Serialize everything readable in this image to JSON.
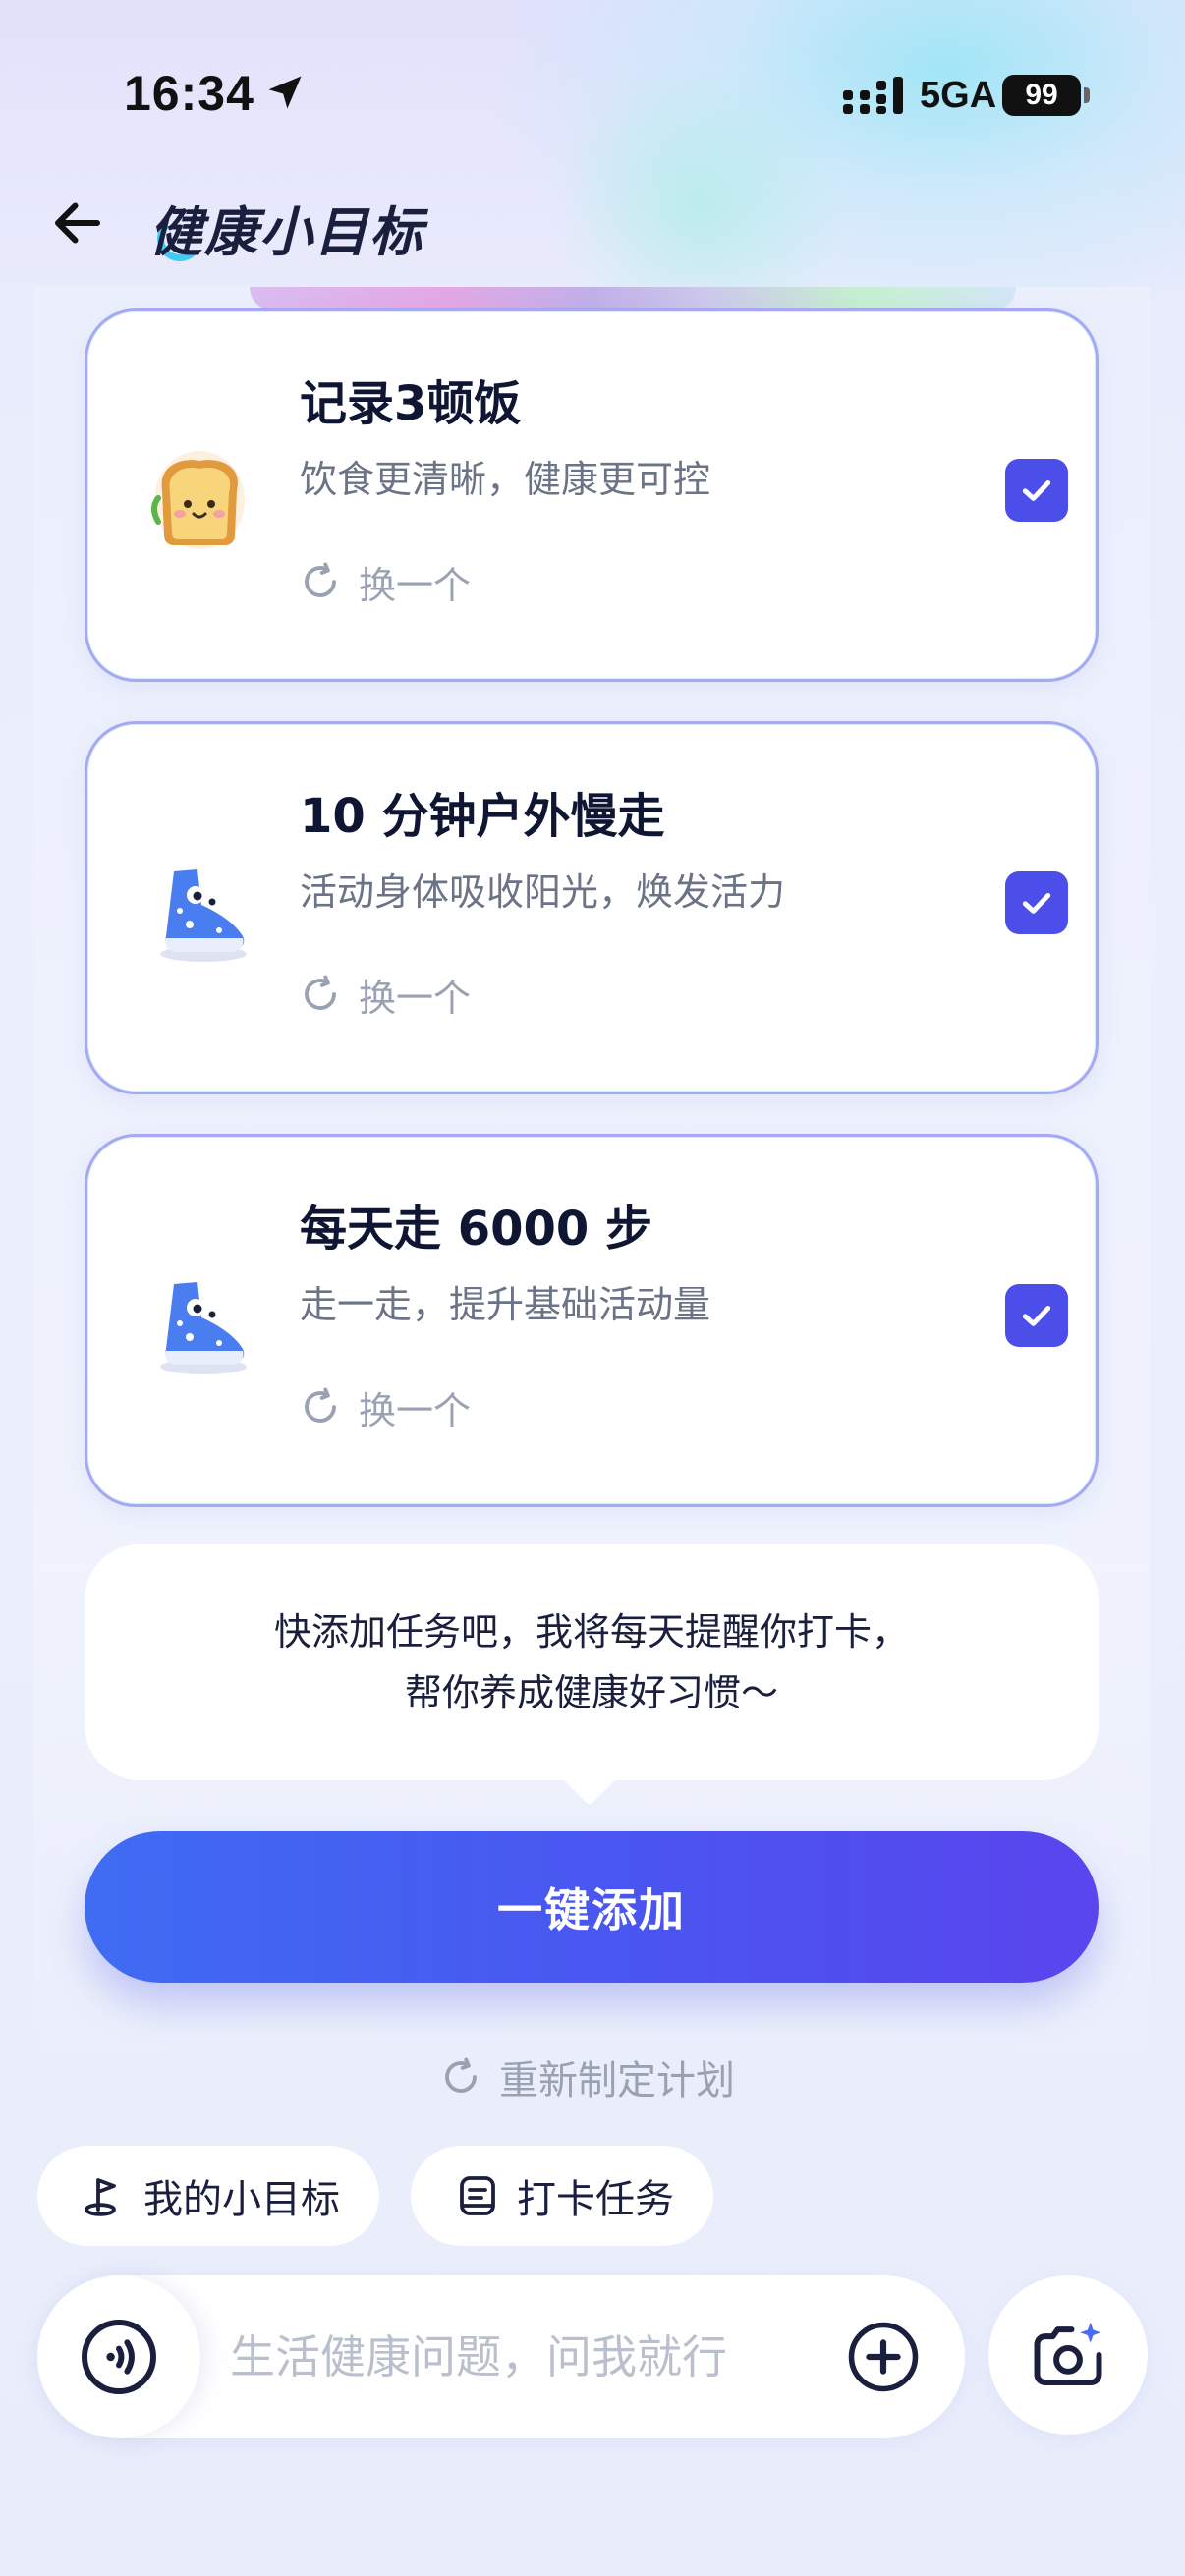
{
  "status_bar": {
    "time": "16:34",
    "network": "5GA",
    "battery": "99"
  },
  "header": {
    "title": "健康小目标"
  },
  "goals": [
    {
      "title": "记录3顿饭",
      "description": "饮食更清晰，健康更可控",
      "swap_label": "换一个",
      "checked": true,
      "icon": "toast-icon"
    },
    {
      "title": "10 分钟户外慢走",
      "description": "活动身体吸收阳光，焕发活力",
      "swap_label": "换一个",
      "checked": true,
      "icon": "sneaker-icon"
    },
    {
      "title": "每天走 6000 步",
      "description": "走一走，提升基础活动量",
      "swap_label": "换一个",
      "checked": true,
      "icon": "sneaker-icon"
    }
  ],
  "hint": {
    "line1": "快添加任务吧，我将每天提醒你打卡，",
    "line2": "帮你养成健康好习惯～"
  },
  "primary_action": "一键添加",
  "replan_label": "重新制定计划",
  "chips": [
    {
      "label": "我的小目标",
      "icon": "goal-flag-icon"
    },
    {
      "label": "打卡任务",
      "icon": "checkin-task-icon"
    }
  ],
  "input": {
    "placeholder": "生活健康问题，问我就行"
  },
  "colors": {
    "accent": "#4b4ee8",
    "button_gradient_start": "#3f6cf3",
    "button_gradient_end": "#5a45ee",
    "card_border": "#a6a9f2",
    "muted_text": "#9aa1b2"
  }
}
